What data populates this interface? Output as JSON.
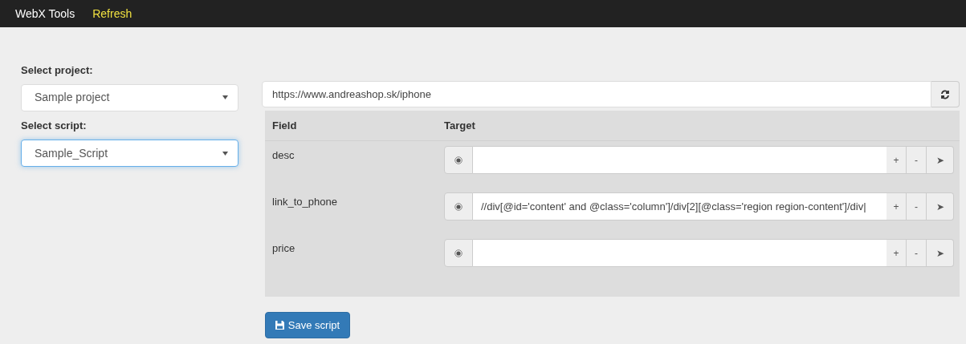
{
  "navbar": {
    "brand": "WebX Tools",
    "link": "Refresh"
  },
  "project_select": {
    "label": "Select project:",
    "value": "Sample project",
    "focused": false
  },
  "script_select": {
    "label": "Select script:",
    "value": "Sample_Script",
    "focused": true
  },
  "url_field": {
    "value": "https://www.andreashop.sk/iphone"
  },
  "table": {
    "columns": [
      "Field",
      "Target"
    ],
    "rows": [
      {
        "field": "desc",
        "target": "",
        "buttons": [
          "+",
          "-",
          "➤"
        ]
      },
      {
        "field": "link_to_phone",
        "target": "//div[@id='content' and @class='column']/div[2][@class='region region-content']/div|",
        "buttons": [
          "+",
          "-",
          "➤"
        ]
      },
      {
        "field": "price",
        "target": "",
        "buttons": [
          "+",
          "-",
          "➤"
        ]
      }
    ]
  },
  "save_button": {
    "label": "Save script"
  }
}
